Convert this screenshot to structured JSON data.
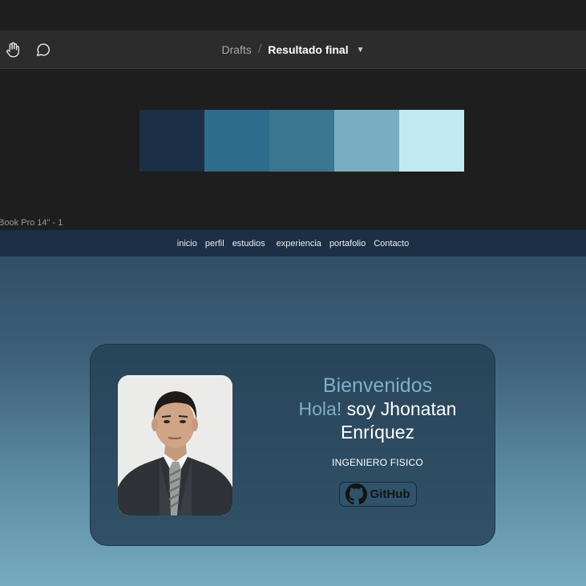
{
  "toolbar": {
    "tools": [
      "hand-tool",
      "comment-tool"
    ],
    "breadcrumb": {
      "drafts": "Drafts",
      "separator": "/",
      "file": "Resultado final"
    }
  },
  "palette": {
    "swatches": [
      "#1b2f46",
      "#2e6b8c",
      "#3a7690",
      "#79adc1",
      "#c2e9f1"
    ]
  },
  "frame_label": "Book Pro 14\" - 1",
  "site": {
    "nav": [
      "inicio",
      "perfil",
      "estudios",
      "experiencia",
      "portafolio",
      "Contacto"
    ],
    "hero": {
      "welcome": "Bienvenidos",
      "hello": "Hola!",
      "name": " soy Jhonatan Enríquez",
      "role": "INGENIERO FISICO",
      "github_label": "GitHub"
    }
  }
}
